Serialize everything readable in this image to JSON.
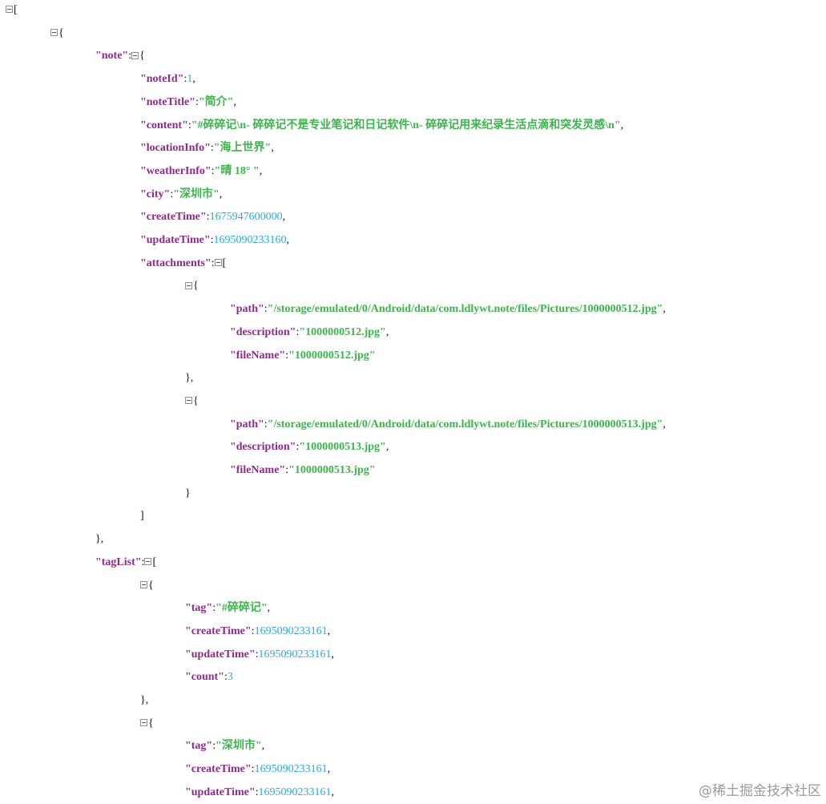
{
  "lines": [
    {
      "indent": 0,
      "toggle": true,
      "parts": [
        {
          "t": "p",
          "v": "["
        }
      ]
    },
    {
      "indent": 1,
      "toggle": true,
      "parts": [
        {
          "t": "p",
          "v": "{"
        }
      ]
    },
    {
      "indent": 2,
      "parts": [
        {
          "t": "k",
          "v": "\"note\""
        },
        {
          "t": "p",
          "v": ":"
        },
        {
          "t": "tog"
        },
        {
          "t": "p",
          "v": "{"
        }
      ]
    },
    {
      "indent": 3,
      "parts": [
        {
          "t": "k",
          "v": "\"noteId\""
        },
        {
          "t": "p",
          "v": ":"
        },
        {
          "t": "n",
          "v": "1"
        },
        {
          "t": "p",
          "v": ","
        }
      ]
    },
    {
      "indent": 3,
      "parts": [
        {
          "t": "k",
          "v": "\"noteTitle\""
        },
        {
          "t": "p",
          "v": ":"
        },
        {
          "t": "s",
          "v": "\"简介\""
        },
        {
          "t": "p",
          "v": ","
        }
      ]
    },
    {
      "indent": 3,
      "parts": [
        {
          "t": "k",
          "v": "\"content\""
        },
        {
          "t": "p",
          "v": ":"
        },
        {
          "t": "s",
          "v": "\"#碎碎记\\n-  碎碎记不是专业笔记和日记软件\\n-  碎碎记用来纪录生活点滴和突发灵感\\n\""
        },
        {
          "t": "p",
          "v": ","
        }
      ]
    },
    {
      "indent": 3,
      "parts": [
        {
          "t": "k",
          "v": "\"locationInfo\""
        },
        {
          "t": "p",
          "v": ":"
        },
        {
          "t": "s",
          "v": "\"海上世界\""
        },
        {
          "t": "p",
          "v": ","
        }
      ]
    },
    {
      "indent": 3,
      "parts": [
        {
          "t": "k",
          "v": "\"weatherInfo\""
        },
        {
          "t": "p",
          "v": ":"
        },
        {
          "t": "s",
          "v": "\"晴  18° \""
        },
        {
          "t": "p",
          "v": ","
        }
      ]
    },
    {
      "indent": 3,
      "parts": [
        {
          "t": "k",
          "v": "\"city\""
        },
        {
          "t": "p",
          "v": ":"
        },
        {
          "t": "s",
          "v": "\"深圳市\""
        },
        {
          "t": "p",
          "v": ","
        }
      ]
    },
    {
      "indent": 3,
      "parts": [
        {
          "t": "k",
          "v": "\"createTime\""
        },
        {
          "t": "p",
          "v": ":"
        },
        {
          "t": "n",
          "v": "1675947600000"
        },
        {
          "t": "p",
          "v": ","
        }
      ]
    },
    {
      "indent": 3,
      "parts": [
        {
          "t": "k",
          "v": "\"updateTime\""
        },
        {
          "t": "p",
          "v": ":"
        },
        {
          "t": "n",
          "v": "1695090233160"
        },
        {
          "t": "p",
          "v": ","
        }
      ]
    },
    {
      "indent": 3,
      "parts": [
        {
          "t": "k",
          "v": "\"attachments\""
        },
        {
          "t": "p",
          "v": ":"
        },
        {
          "t": "tog"
        },
        {
          "t": "p",
          "v": "["
        }
      ]
    },
    {
      "indent": 4,
      "toggle": true,
      "parts": [
        {
          "t": "p",
          "v": "{"
        }
      ]
    },
    {
      "indent": 5,
      "parts": [
        {
          "t": "k",
          "v": "\"path\""
        },
        {
          "t": "p",
          "v": ":"
        },
        {
          "t": "s",
          "v": "\"/storage/emulated/0/Android/data/com.ldlywt.note/files/Pictures/1000000512.jpg\""
        },
        {
          "t": "p",
          "v": ","
        }
      ]
    },
    {
      "indent": 5,
      "parts": [
        {
          "t": "k",
          "v": "\"description\""
        },
        {
          "t": "p",
          "v": ":"
        },
        {
          "t": "s",
          "v": "\"1000000512.jpg\""
        },
        {
          "t": "p",
          "v": ","
        }
      ]
    },
    {
      "indent": 5,
      "parts": [
        {
          "t": "k",
          "v": "\"fileName\""
        },
        {
          "t": "p",
          "v": ":"
        },
        {
          "t": "s",
          "v": "\"1000000512.jpg\""
        }
      ]
    },
    {
      "indent": 4,
      "parts": [
        {
          "t": "p",
          "v": "},"
        }
      ]
    },
    {
      "indent": 4,
      "toggle": true,
      "parts": [
        {
          "t": "p",
          "v": "{"
        }
      ]
    },
    {
      "indent": 5,
      "parts": [
        {
          "t": "k",
          "v": "\"path\""
        },
        {
          "t": "p",
          "v": ":"
        },
        {
          "t": "s",
          "v": "\"/storage/emulated/0/Android/data/com.ldlywt.note/files/Pictures/1000000513.jpg\""
        },
        {
          "t": "p",
          "v": ","
        }
      ]
    },
    {
      "indent": 5,
      "parts": [
        {
          "t": "k",
          "v": "\"description\""
        },
        {
          "t": "p",
          "v": ":"
        },
        {
          "t": "s",
          "v": "\"1000000513.jpg\""
        },
        {
          "t": "p",
          "v": ","
        }
      ]
    },
    {
      "indent": 5,
      "parts": [
        {
          "t": "k",
          "v": "\"fileName\""
        },
        {
          "t": "p",
          "v": ":"
        },
        {
          "t": "s",
          "v": "\"1000000513.jpg\""
        }
      ]
    },
    {
      "indent": 4,
      "parts": [
        {
          "t": "p",
          "v": "}"
        }
      ]
    },
    {
      "indent": 3,
      "parts": [
        {
          "t": "p",
          "v": "]"
        }
      ]
    },
    {
      "indent": 2,
      "parts": [
        {
          "t": "p",
          "v": "},"
        }
      ]
    },
    {
      "indent": 2,
      "parts": [
        {
          "t": "k",
          "v": "\"tagList\""
        },
        {
          "t": "p",
          "v": ":"
        },
        {
          "t": "tog"
        },
        {
          "t": "p",
          "v": "["
        }
      ]
    },
    {
      "indent": 3,
      "toggle": true,
      "parts": [
        {
          "t": "p",
          "v": "{"
        }
      ]
    },
    {
      "indent": 4,
      "parts": [
        {
          "t": "k",
          "v": "\"tag\""
        },
        {
          "t": "p",
          "v": ":"
        },
        {
          "t": "s",
          "v": "\"#碎碎记\""
        },
        {
          "t": "p",
          "v": ","
        }
      ]
    },
    {
      "indent": 4,
      "parts": [
        {
          "t": "k",
          "v": "\"createTime\""
        },
        {
          "t": "p",
          "v": ":"
        },
        {
          "t": "n",
          "v": "1695090233161"
        },
        {
          "t": "p",
          "v": ","
        }
      ]
    },
    {
      "indent": 4,
      "parts": [
        {
          "t": "k",
          "v": "\"updateTime\""
        },
        {
          "t": "p",
          "v": ":"
        },
        {
          "t": "n",
          "v": "1695090233161"
        },
        {
          "t": "p",
          "v": ","
        }
      ]
    },
    {
      "indent": 4,
      "parts": [
        {
          "t": "k",
          "v": "\"count\""
        },
        {
          "t": "p",
          "v": ":"
        },
        {
          "t": "n",
          "v": "3"
        }
      ]
    },
    {
      "indent": 3,
      "parts": [
        {
          "t": "p",
          "v": "},"
        }
      ]
    },
    {
      "indent": 3,
      "toggle": true,
      "parts": [
        {
          "t": "p",
          "v": "{"
        }
      ]
    },
    {
      "indent": 4,
      "parts": [
        {
          "t": "k",
          "v": "\"tag\""
        },
        {
          "t": "p",
          "v": ":"
        },
        {
          "t": "s",
          "v": "\"深圳市\""
        },
        {
          "t": "p",
          "v": ","
        }
      ]
    },
    {
      "indent": 4,
      "parts": [
        {
          "t": "k",
          "v": "\"createTime\""
        },
        {
          "t": "p",
          "v": ":"
        },
        {
          "t": "n",
          "v": "1695090233161"
        },
        {
          "t": "p",
          "v": ","
        }
      ]
    },
    {
      "indent": 4,
      "parts": [
        {
          "t": "k",
          "v": "\"updateTime\""
        },
        {
          "t": "p",
          "v": ":"
        },
        {
          "t": "n",
          "v": "1695090233161"
        },
        {
          "t": "p",
          "v": ","
        }
      ]
    }
  ],
  "watermark": "@稀土掘金技术社区",
  "colors": {
    "key": "#92278f",
    "string": "#3ab54a",
    "number": "#25aae2",
    "punctuation": "#111111"
  }
}
